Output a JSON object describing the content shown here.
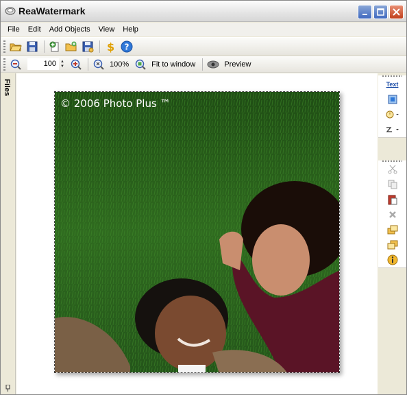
{
  "window": {
    "title": "ReaWatermark"
  },
  "menu": {
    "items": [
      "File",
      "Edit",
      "Add Objects",
      "View",
      "Help"
    ]
  },
  "toolbar2": {
    "zoom_value": "100",
    "zoom_100_label": "100%",
    "fit_label": "Fit to window",
    "preview_label": "Preview"
  },
  "files_panel": {
    "label": "Files"
  },
  "canvas": {
    "watermark_text": "© 2006 Photo Plus ™"
  },
  "right_panel": {
    "text_label": "Text"
  },
  "colors": {
    "accent": "#3f69c0",
    "close": "#c1401c",
    "grass": "#2f6b1f"
  }
}
